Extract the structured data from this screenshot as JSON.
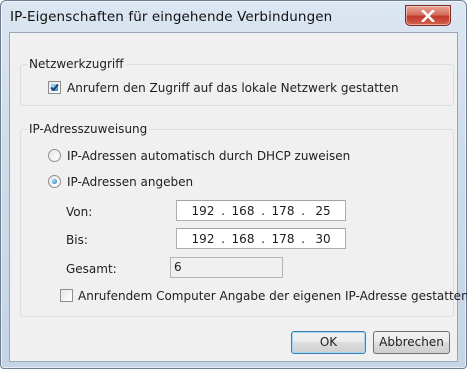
{
  "window": {
    "title": "IP-Eigenschaften für eingehende Verbindungen",
    "close_icon": "close-x-icon"
  },
  "network_access": {
    "legend": "Netzwerkzugriff",
    "allow_local_network": {
      "label": "Anrufern den Zugriff auf das lokale Netzwerk gestatten",
      "checked": true
    }
  },
  "ip_assignment": {
    "legend": "IP-Adresszuweisung",
    "options": [
      {
        "label": "IP-Adressen automatisch durch DHCP zuweisen",
        "selected": false
      },
      {
        "label": "IP-Adressen angeben",
        "selected": true
      }
    ],
    "from": {
      "label": "Von:",
      "octets": [
        "192",
        "168",
        "178",
        "25"
      ]
    },
    "to": {
      "label": "Bis:",
      "octets": [
        "192",
        "168",
        "178",
        "30"
      ]
    },
    "total": {
      "label": "Gesamt:",
      "value": "6"
    },
    "allow_own_ip": {
      "label": "Anrufendem Computer Angabe der eigenen IP-Adresse gestatten",
      "checked": false
    }
  },
  "buttons": {
    "ok": "OK",
    "cancel": "Abbrechen"
  },
  "colors": {
    "close_button": "#c0392b",
    "accent": "#3c7fb1"
  }
}
